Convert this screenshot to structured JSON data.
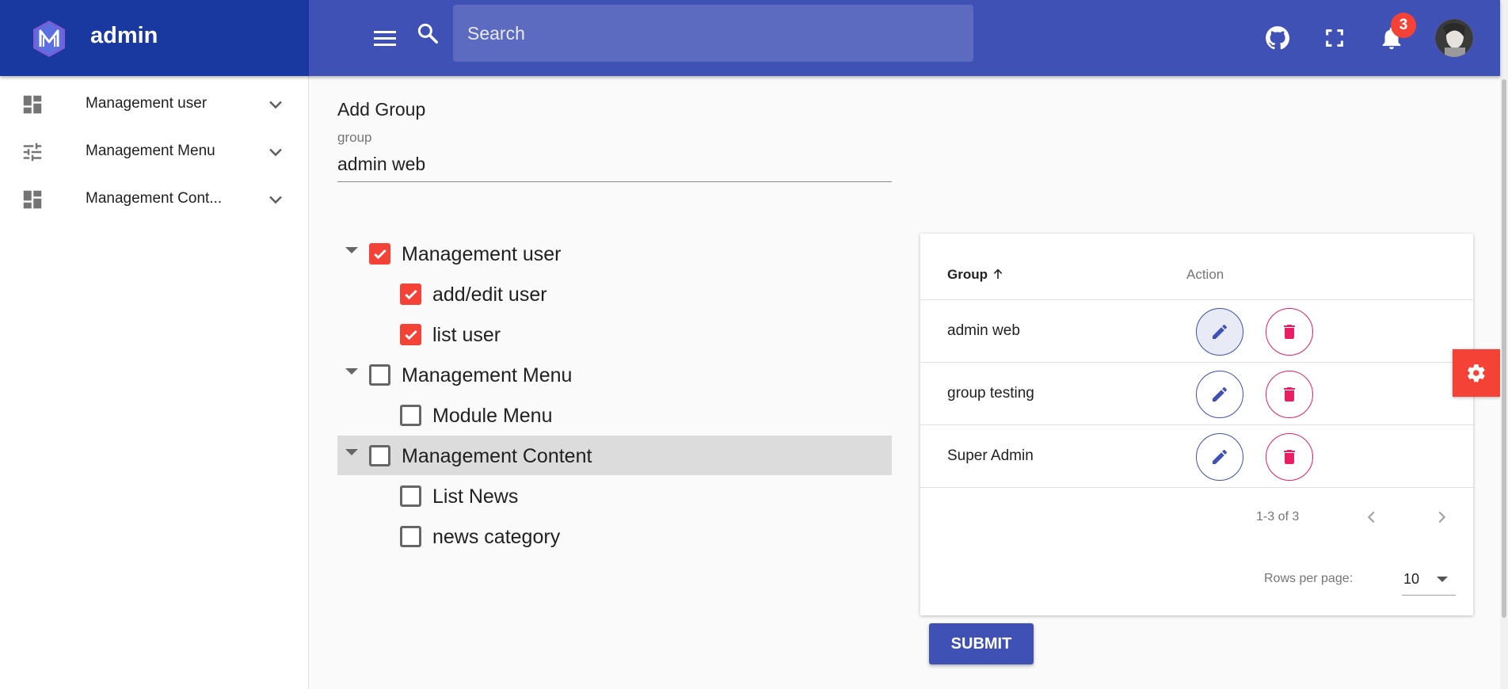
{
  "app": {
    "name": "admin"
  },
  "search": {
    "placeholder": "Search"
  },
  "notifications": {
    "count": "3"
  },
  "sidebar": {
    "items": [
      {
        "label": "Management user",
        "icon": "dashboard-icon"
      },
      {
        "label": "Management Menu",
        "icon": "tune-icon"
      },
      {
        "label": "Management Cont...",
        "icon": "dashboard-icon"
      }
    ]
  },
  "form": {
    "title": "Add Group",
    "group_label": "group",
    "group_value": "admin web"
  },
  "tree": [
    {
      "label": "Management user",
      "checked": true,
      "level": 0
    },
    {
      "label": "add/edit user",
      "checked": true,
      "level": 1
    },
    {
      "label": "list user",
      "checked": true,
      "level": 1
    },
    {
      "label": "Management Menu",
      "checked": false,
      "level": 0
    },
    {
      "label": "Module Menu",
      "checked": false,
      "level": 1
    },
    {
      "label": "Management Content",
      "checked": false,
      "level": 0,
      "highlighted": true
    },
    {
      "label": "List News",
      "checked": false,
      "level": 1
    },
    {
      "label": "news category",
      "checked": false,
      "level": 1
    }
  ],
  "table": {
    "columns": {
      "group": "Group",
      "action": "Action"
    },
    "rows": [
      {
        "group": "admin web"
      },
      {
        "group": "group testing"
      },
      {
        "group": "Super Admin"
      }
    ],
    "pagination": "1-3 of 3",
    "rows_per_page_label": "Rows per page:",
    "rows_per_page": "10"
  },
  "submit_label": "Submit",
  "colors": {
    "primary": "#3f51b5",
    "brand_dark": "#1a39a0",
    "checkbox_on": "#f44336",
    "delete": "#e91e63"
  }
}
